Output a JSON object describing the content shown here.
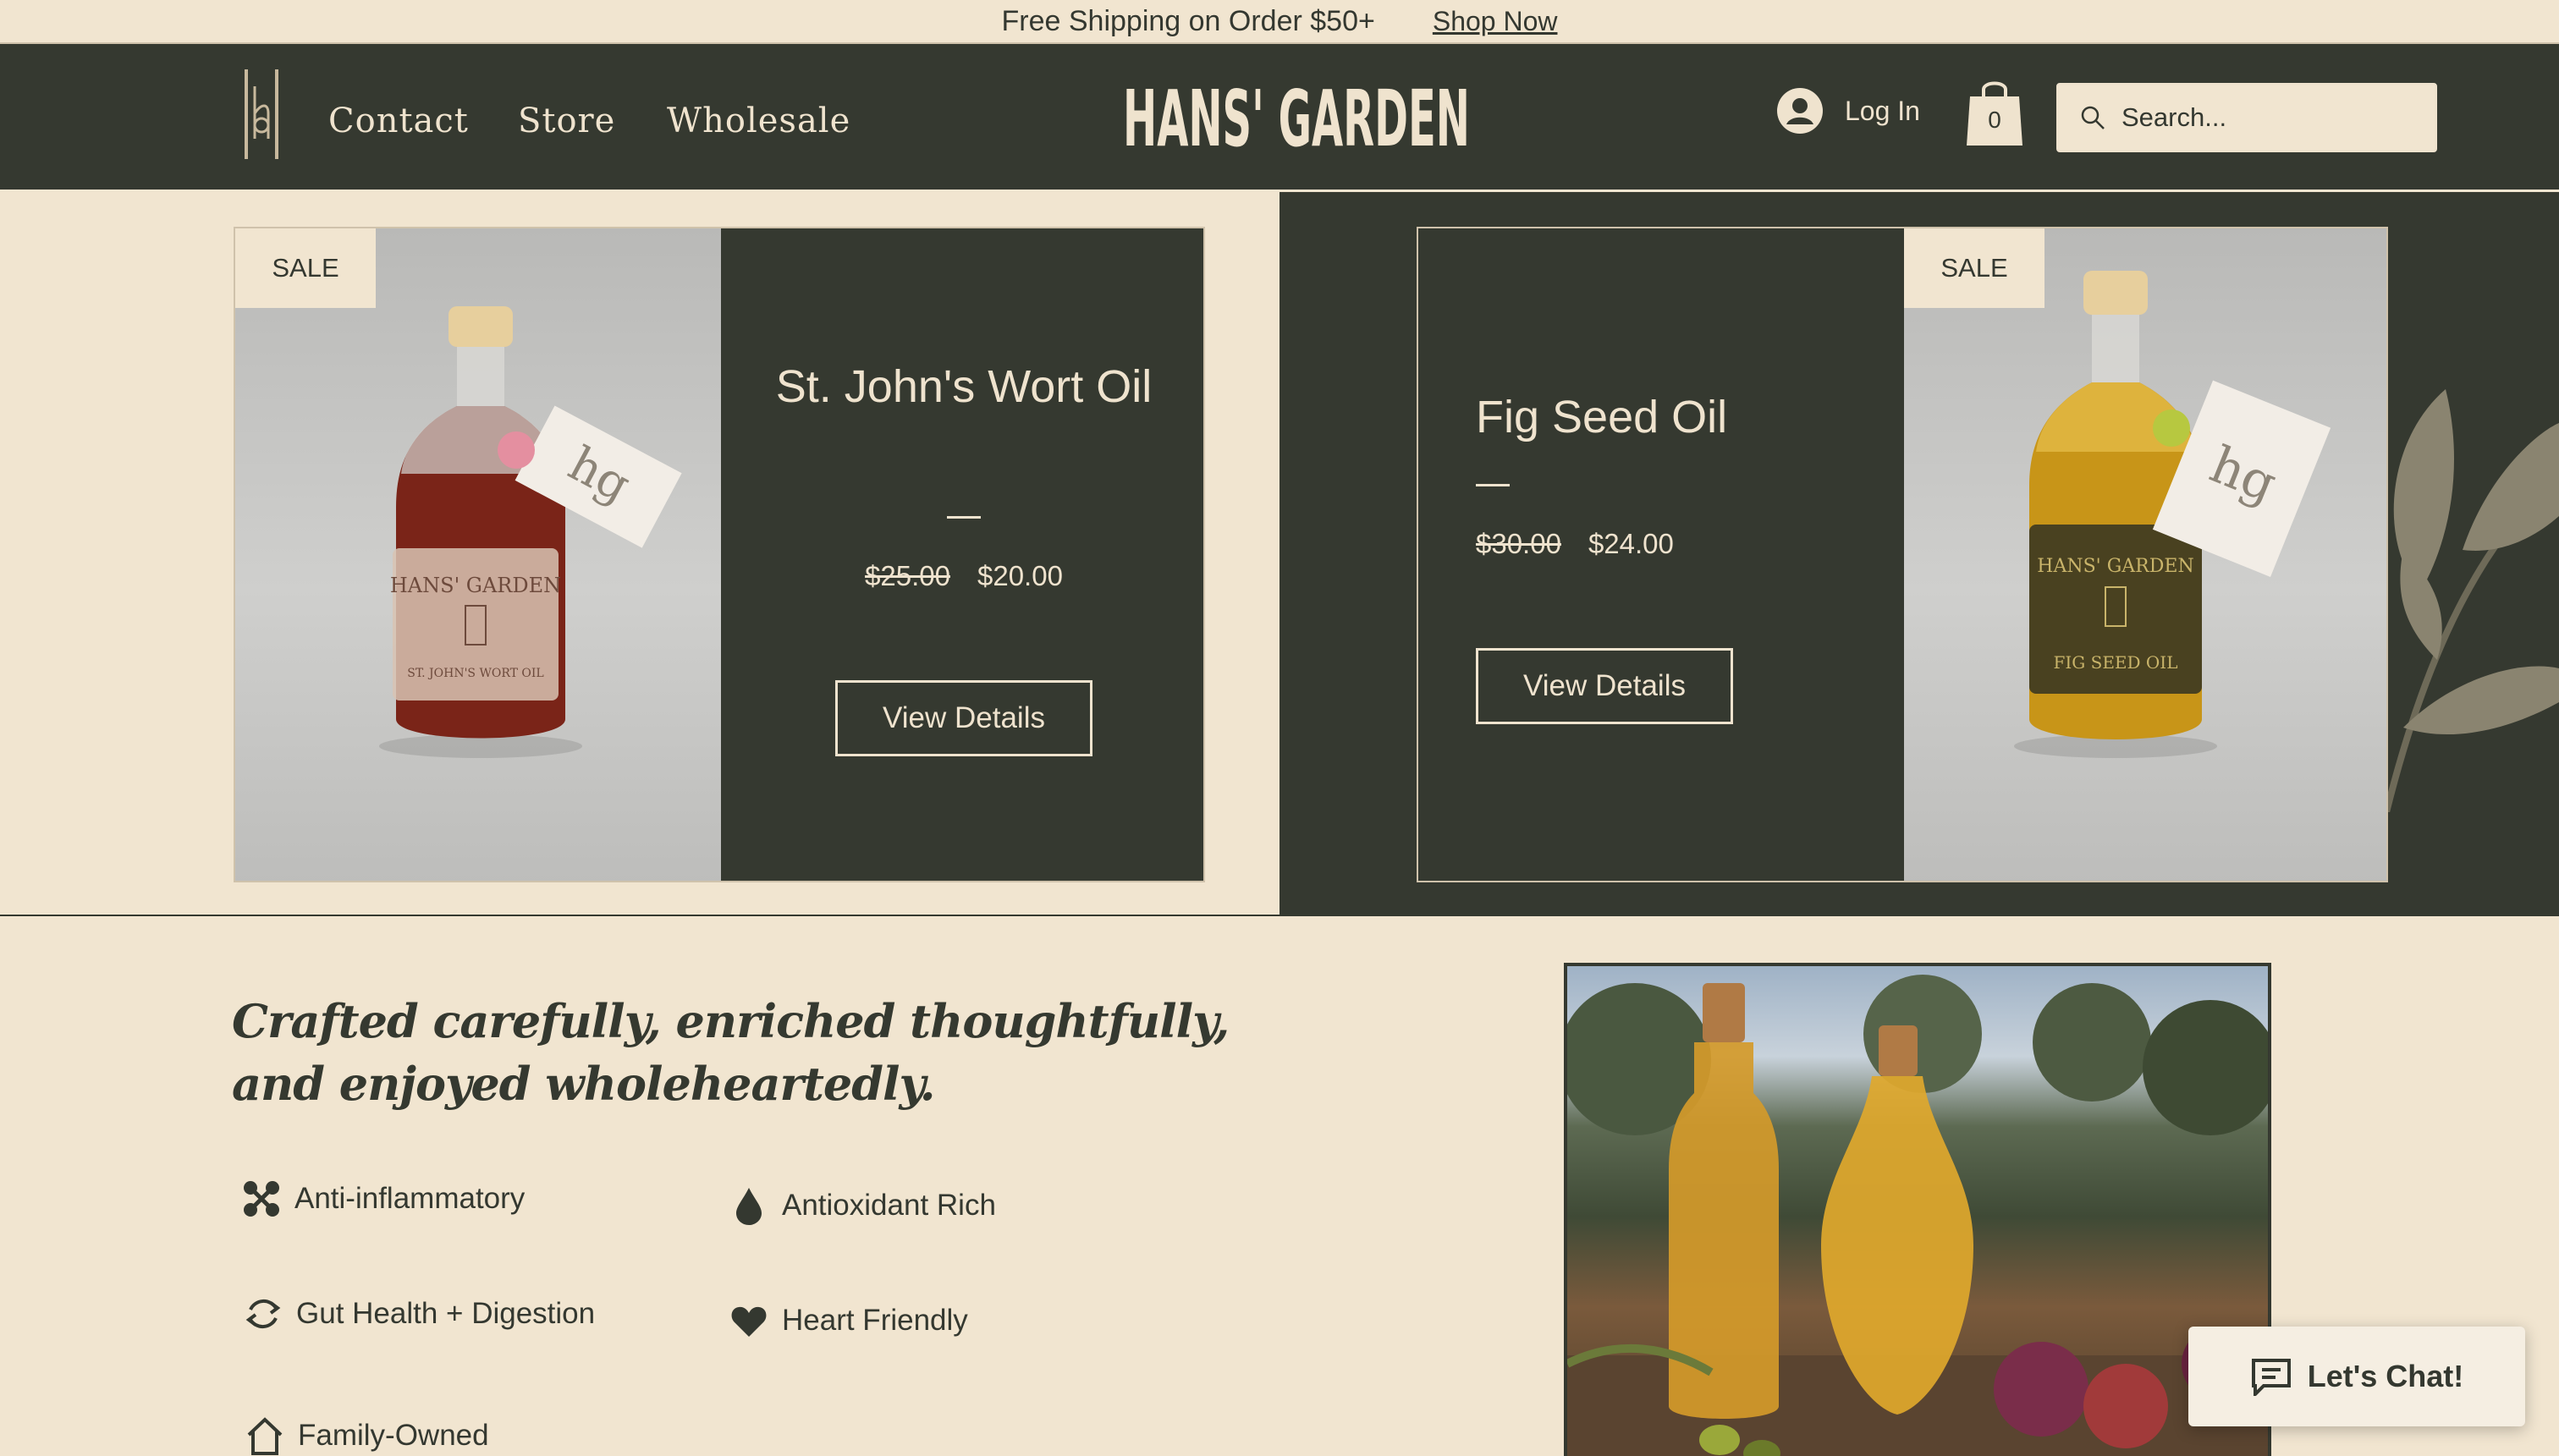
{
  "announcement": {
    "message": "Free Shipping on Order $50+",
    "link": "Shop Now"
  },
  "header": {
    "logo_icon": "hg-monogram-icon",
    "nav": [
      "Contact",
      "Store",
      "Wholesale"
    ],
    "brand": "HANS' GARDEN",
    "login_label": "Log In",
    "cart_count": "0",
    "search_placeholder": "Search..."
  },
  "products": [
    {
      "badge": "SALE",
      "name": "St. John's Wort Oil",
      "old_price": "$25.00",
      "price": "$20.00",
      "button": "View Details",
      "label_lines": [
        "HANS' GARDEN",
        "ST. JOHN'S WORT OIL"
      ]
    },
    {
      "badge": "SALE",
      "name": "Fig Seed Oil",
      "old_price": "$30.00",
      "price": "$24.00",
      "button": "View Details",
      "label_lines": [
        "HANS' GARDEN",
        "FIG SEED OIL"
      ]
    }
  ],
  "tagline": "Crafted carefully, enriched thoughtfully, and enjoyed wholeheartedly.",
  "features": [
    {
      "icon": "molecule-icon",
      "label": "Anti-inflammatory"
    },
    {
      "icon": "droplet-icon",
      "label": "Antioxidant Rich"
    },
    {
      "icon": "cycle-icon",
      "label": "Gut Health + Digestion"
    },
    {
      "icon": "heart-icon",
      "label": "Heart Friendly"
    },
    {
      "icon": "home-icon",
      "label": "Family-Owned"
    }
  ],
  "chat": {
    "label": "Let's Chat!"
  },
  "colors": {
    "dark": "#353930",
    "cream": "#f1e5d0",
    "light_text": "#efe3ce"
  }
}
